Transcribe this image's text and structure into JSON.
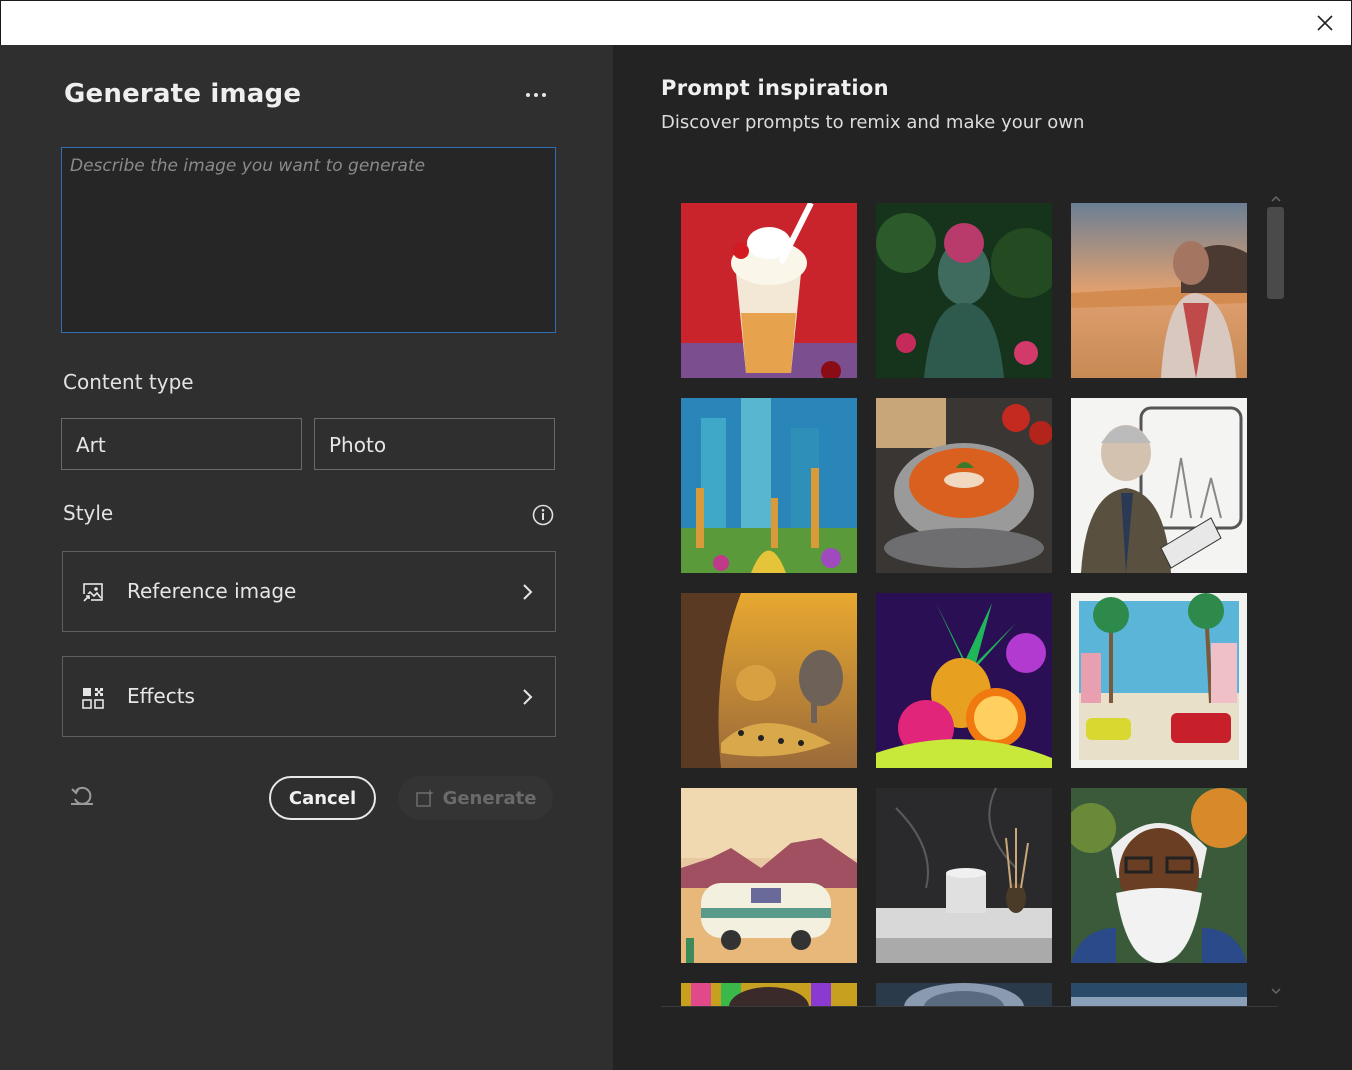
{
  "dialog": {
    "title": "Generate image",
    "more_label": "...",
    "prompt_placeholder": "Describe the image you want to generate",
    "content_type_label": "Content type",
    "content_types": [
      "Art",
      "Photo"
    ],
    "style_label": "Style",
    "reference_image_label": "Reference image",
    "effects_label": "Effects",
    "cancel_label": "Cancel",
    "generate_label": "Generate"
  },
  "inspiration": {
    "title": "Prompt inspiration",
    "subtitle": "Discover prompts to remix and make your own"
  },
  "colors": {
    "focus_border": "#2f6fb5",
    "left_bg": "#2f2f2f",
    "right_bg": "#232323"
  }
}
